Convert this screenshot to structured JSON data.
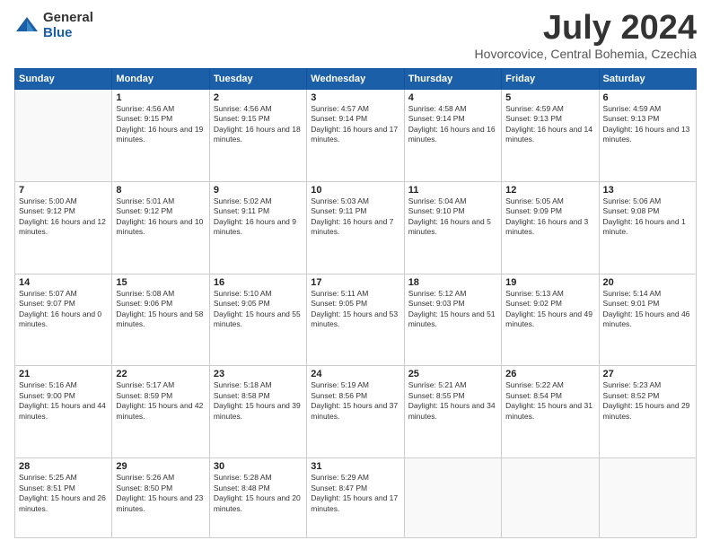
{
  "logo": {
    "general": "General",
    "blue": "Blue"
  },
  "title": {
    "month_year": "July 2024",
    "location": "Hovorcovice, Central Bohemia, Czechia"
  },
  "headers": [
    "Sunday",
    "Monday",
    "Tuesday",
    "Wednesday",
    "Thursday",
    "Friday",
    "Saturday"
  ],
  "weeks": [
    [
      {
        "day": "",
        "sunrise": "",
        "sunset": "",
        "daylight": ""
      },
      {
        "day": "1",
        "sunrise": "Sunrise: 4:56 AM",
        "sunset": "Sunset: 9:15 PM",
        "daylight": "Daylight: 16 hours and 19 minutes."
      },
      {
        "day": "2",
        "sunrise": "Sunrise: 4:56 AM",
        "sunset": "Sunset: 9:15 PM",
        "daylight": "Daylight: 16 hours and 18 minutes."
      },
      {
        "day": "3",
        "sunrise": "Sunrise: 4:57 AM",
        "sunset": "Sunset: 9:14 PM",
        "daylight": "Daylight: 16 hours and 17 minutes."
      },
      {
        "day": "4",
        "sunrise": "Sunrise: 4:58 AM",
        "sunset": "Sunset: 9:14 PM",
        "daylight": "Daylight: 16 hours and 16 minutes."
      },
      {
        "day": "5",
        "sunrise": "Sunrise: 4:59 AM",
        "sunset": "Sunset: 9:13 PM",
        "daylight": "Daylight: 16 hours and 14 minutes."
      },
      {
        "day": "6",
        "sunrise": "Sunrise: 4:59 AM",
        "sunset": "Sunset: 9:13 PM",
        "daylight": "Daylight: 16 hours and 13 minutes."
      }
    ],
    [
      {
        "day": "7",
        "sunrise": "Sunrise: 5:00 AM",
        "sunset": "Sunset: 9:12 PM",
        "daylight": "Daylight: 16 hours and 12 minutes."
      },
      {
        "day": "8",
        "sunrise": "Sunrise: 5:01 AM",
        "sunset": "Sunset: 9:12 PM",
        "daylight": "Daylight: 16 hours and 10 minutes."
      },
      {
        "day": "9",
        "sunrise": "Sunrise: 5:02 AM",
        "sunset": "Sunset: 9:11 PM",
        "daylight": "Daylight: 16 hours and 9 minutes."
      },
      {
        "day": "10",
        "sunrise": "Sunrise: 5:03 AM",
        "sunset": "Sunset: 9:11 PM",
        "daylight": "Daylight: 16 hours and 7 minutes."
      },
      {
        "day": "11",
        "sunrise": "Sunrise: 5:04 AM",
        "sunset": "Sunset: 9:10 PM",
        "daylight": "Daylight: 16 hours and 5 minutes."
      },
      {
        "day": "12",
        "sunrise": "Sunrise: 5:05 AM",
        "sunset": "Sunset: 9:09 PM",
        "daylight": "Daylight: 16 hours and 3 minutes."
      },
      {
        "day": "13",
        "sunrise": "Sunrise: 5:06 AM",
        "sunset": "Sunset: 9:08 PM",
        "daylight": "Daylight: 16 hours and 1 minute."
      }
    ],
    [
      {
        "day": "14",
        "sunrise": "Sunrise: 5:07 AM",
        "sunset": "Sunset: 9:07 PM",
        "daylight": "Daylight: 16 hours and 0 minutes."
      },
      {
        "day": "15",
        "sunrise": "Sunrise: 5:08 AM",
        "sunset": "Sunset: 9:06 PM",
        "daylight": "Daylight: 15 hours and 58 minutes."
      },
      {
        "day": "16",
        "sunrise": "Sunrise: 5:10 AM",
        "sunset": "Sunset: 9:05 PM",
        "daylight": "Daylight: 15 hours and 55 minutes."
      },
      {
        "day": "17",
        "sunrise": "Sunrise: 5:11 AM",
        "sunset": "Sunset: 9:05 PM",
        "daylight": "Daylight: 15 hours and 53 minutes."
      },
      {
        "day": "18",
        "sunrise": "Sunrise: 5:12 AM",
        "sunset": "Sunset: 9:03 PM",
        "daylight": "Daylight: 15 hours and 51 minutes."
      },
      {
        "day": "19",
        "sunrise": "Sunrise: 5:13 AM",
        "sunset": "Sunset: 9:02 PM",
        "daylight": "Daylight: 15 hours and 49 minutes."
      },
      {
        "day": "20",
        "sunrise": "Sunrise: 5:14 AM",
        "sunset": "Sunset: 9:01 PM",
        "daylight": "Daylight: 15 hours and 46 minutes."
      }
    ],
    [
      {
        "day": "21",
        "sunrise": "Sunrise: 5:16 AM",
        "sunset": "Sunset: 9:00 PM",
        "daylight": "Daylight: 15 hours and 44 minutes."
      },
      {
        "day": "22",
        "sunrise": "Sunrise: 5:17 AM",
        "sunset": "Sunset: 8:59 PM",
        "daylight": "Daylight: 15 hours and 42 minutes."
      },
      {
        "day": "23",
        "sunrise": "Sunrise: 5:18 AM",
        "sunset": "Sunset: 8:58 PM",
        "daylight": "Daylight: 15 hours and 39 minutes."
      },
      {
        "day": "24",
        "sunrise": "Sunrise: 5:19 AM",
        "sunset": "Sunset: 8:56 PM",
        "daylight": "Daylight: 15 hours and 37 minutes."
      },
      {
        "day": "25",
        "sunrise": "Sunrise: 5:21 AM",
        "sunset": "Sunset: 8:55 PM",
        "daylight": "Daylight: 15 hours and 34 minutes."
      },
      {
        "day": "26",
        "sunrise": "Sunrise: 5:22 AM",
        "sunset": "Sunset: 8:54 PM",
        "daylight": "Daylight: 15 hours and 31 minutes."
      },
      {
        "day": "27",
        "sunrise": "Sunrise: 5:23 AM",
        "sunset": "Sunset: 8:52 PM",
        "daylight": "Daylight: 15 hours and 29 minutes."
      }
    ],
    [
      {
        "day": "28",
        "sunrise": "Sunrise: 5:25 AM",
        "sunset": "Sunset: 8:51 PM",
        "daylight": "Daylight: 15 hours and 26 minutes."
      },
      {
        "day": "29",
        "sunrise": "Sunrise: 5:26 AM",
        "sunset": "Sunset: 8:50 PM",
        "daylight": "Daylight: 15 hours and 23 minutes."
      },
      {
        "day": "30",
        "sunrise": "Sunrise: 5:28 AM",
        "sunset": "Sunset: 8:48 PM",
        "daylight": "Daylight: 15 hours and 20 minutes."
      },
      {
        "day": "31",
        "sunrise": "Sunrise: 5:29 AM",
        "sunset": "Sunset: 8:47 PM",
        "daylight": "Daylight: 15 hours and 17 minutes."
      },
      {
        "day": "",
        "sunrise": "",
        "sunset": "",
        "daylight": ""
      },
      {
        "day": "",
        "sunrise": "",
        "sunset": "",
        "daylight": ""
      },
      {
        "day": "",
        "sunrise": "",
        "sunset": "",
        "daylight": ""
      }
    ]
  ]
}
